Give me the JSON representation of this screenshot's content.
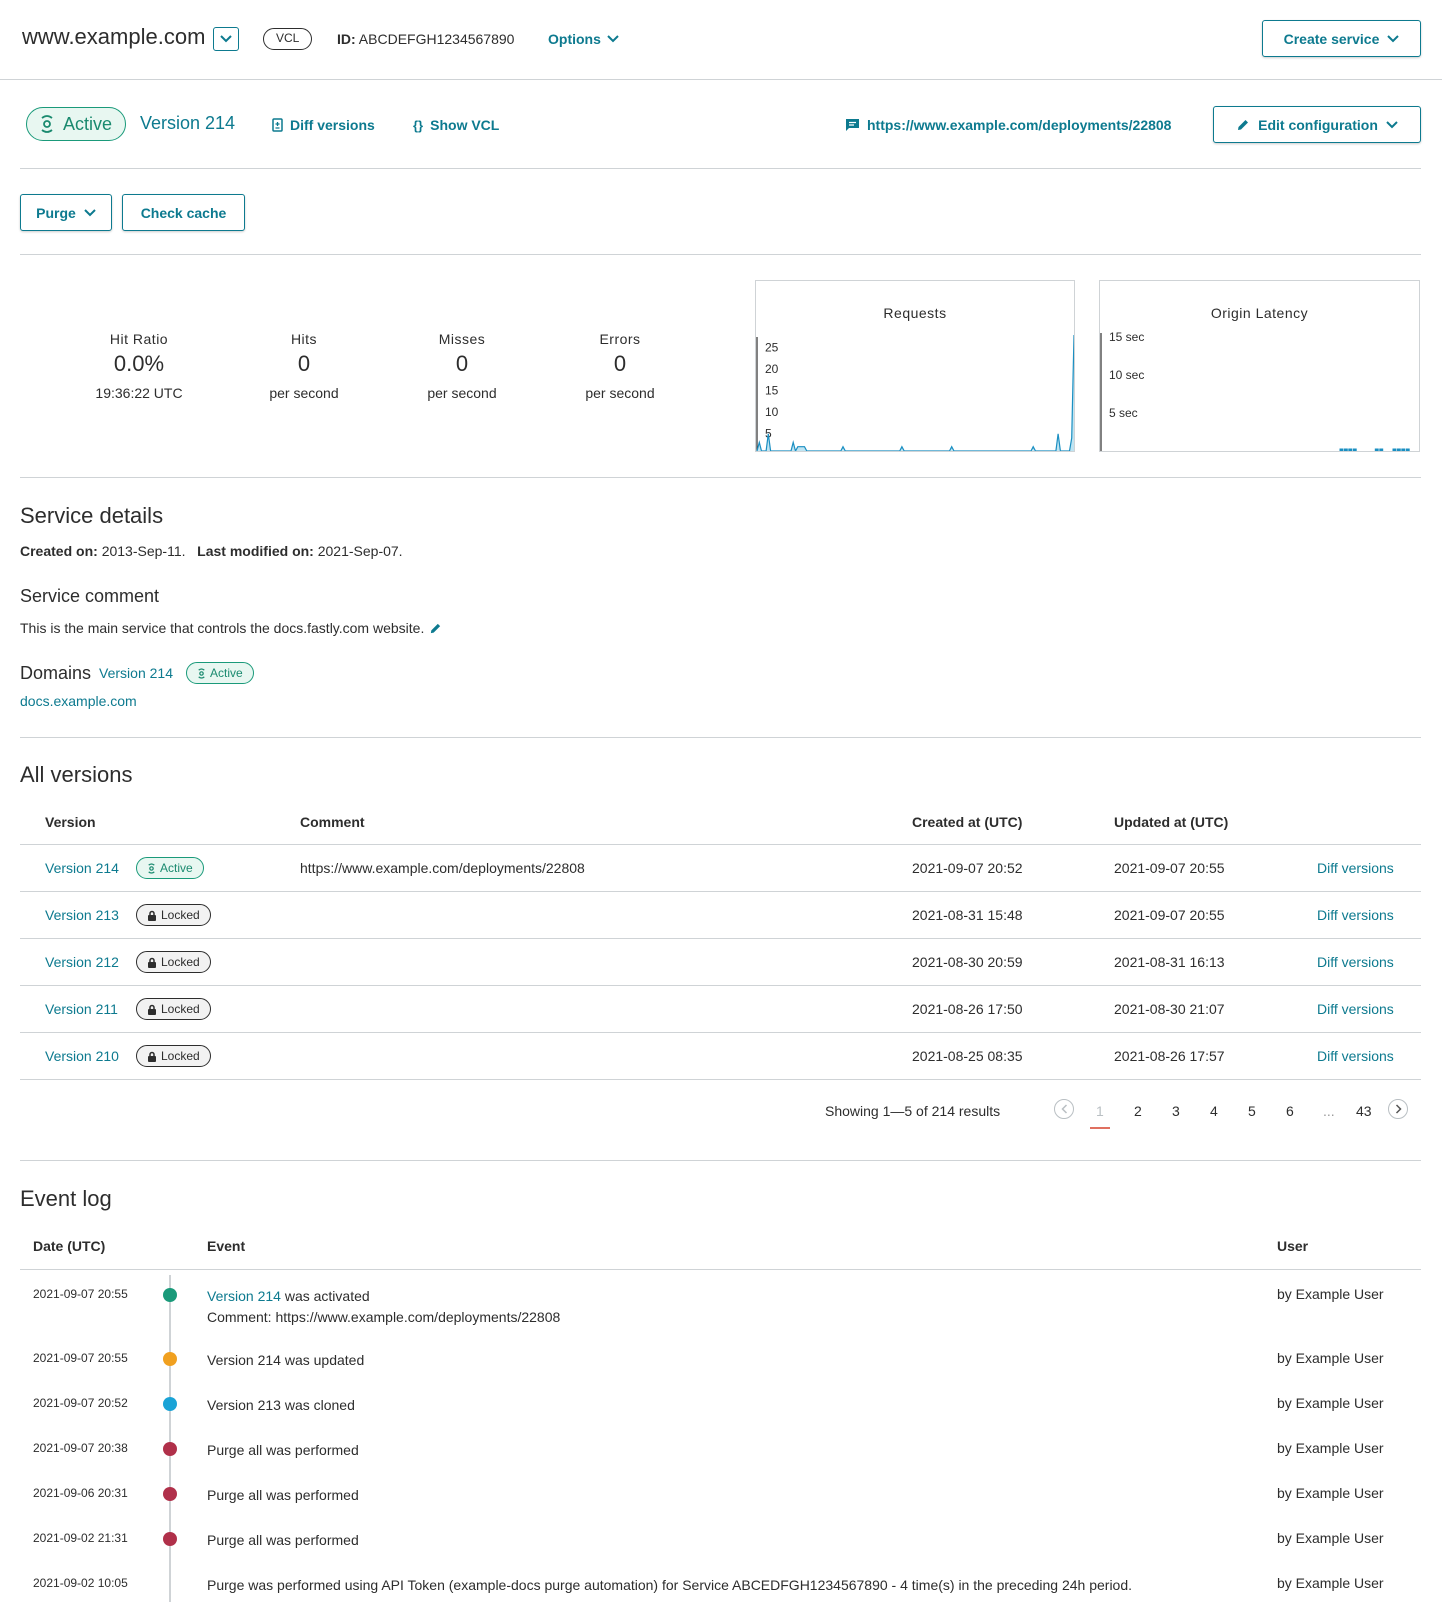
{
  "header": {
    "site_title": "www.example.com",
    "type_badge": "VCL",
    "id_label": "ID:",
    "id_value": "ABCDEFGH1234567890",
    "options_label": "Options",
    "create_service_label": "Create service"
  },
  "version_bar": {
    "status": "Active",
    "version_label": "Version 214",
    "diff_versions_label": "Diff versions",
    "show_vcl_label": "Show VCL",
    "deployment_url": "https://www.example.com/deployments/22808",
    "edit_config_label": "Edit configuration"
  },
  "actions": {
    "purge_label": "Purge",
    "check_cache_label": "Check cache"
  },
  "stats": {
    "hit_ratio": {
      "label": "Hit Ratio",
      "value": "0.0%",
      "sub": "19:36:22 UTC"
    },
    "hits": {
      "label": "Hits",
      "value": "0",
      "sub": "per second"
    },
    "misses": {
      "label": "Misses",
      "value": "0",
      "sub": "per second"
    },
    "errors": {
      "label": "Errors",
      "value": "0",
      "sub": "per second"
    }
  },
  "chart_data": [
    {
      "type": "area",
      "title": "Requests",
      "yticks": [
        "25",
        "20",
        "15",
        "10",
        "5"
      ],
      "ylim": [
        0,
        27
      ],
      "values": [
        0,
        2,
        0,
        0,
        0,
        4,
        0,
        0,
        0,
        0,
        0,
        0,
        0,
        0,
        0,
        0,
        2,
        0,
        1,
        1,
        1,
        1,
        0,
        0,
        0,
        0,
        0,
        0,
        0,
        0,
        0,
        0,
        0,
        0,
        0,
        0,
        0,
        0,
        1,
        0,
        0,
        0,
        0,
        0,
        0,
        0,
        0,
        0,
        0,
        0,
        0,
        0,
        0,
        0,
        0,
        0,
        0,
        0,
        0,
        0,
        0,
        0,
        0,
        0,
        1,
        0,
        0,
        0,
        0,
        0,
        0,
        0,
        0,
        0,
        0,
        0,
        0,
        0,
        0,
        0,
        0,
        0,
        0,
        0,
        0,
        0,
        1,
        0,
        0,
        0,
        0,
        0,
        0,
        0,
        0,
        0,
        0,
        0,
        0,
        0,
        0,
        0,
        0,
        0,
        0,
        0,
        0,
        0,
        0,
        0,
        0,
        0,
        0,
        0,
        0,
        0,
        0,
        0,
        0,
        0,
        0,
        0,
        1,
        0,
        0,
        0,
        0,
        0,
        0,
        0,
        0,
        0,
        0,
        4,
        0,
        0,
        0,
        0,
        0,
        3,
        27
      ],
      "legend": "none"
    },
    {
      "type": "bar",
      "title": "Origin Latency",
      "yticks": [
        "15 sec",
        "10 sec",
        "5 sec"
      ],
      "ylim": [
        0,
        15
      ],
      "values": [
        0,
        0,
        0,
        0,
        0,
        0,
        0,
        0,
        0,
        0,
        0,
        0,
        0,
        0,
        0,
        0,
        0,
        0,
        0,
        0,
        0,
        0,
        0,
        0,
        0,
        0,
        0,
        0,
        0,
        0,
        0,
        0,
        0,
        0,
        0,
        0,
        0,
        0,
        0,
        0,
        0,
        0,
        0,
        0,
        0,
        0,
        0,
        0,
        0,
        0,
        0,
        0,
        0,
        0,
        0.2,
        0.2,
        0.2,
        0.2,
        0,
        0,
        0,
        0,
        0.2,
        0.2,
        0,
        0,
        0.2,
        0.2,
        0.2,
        0.2,
        0,
        0
      ],
      "legend": "none"
    }
  ],
  "service_details": {
    "heading": "Service details",
    "created_label": "Created on:",
    "created_value": "2013-Sep-11.",
    "modified_label": "Last modified on:",
    "modified_value": "2021-Sep-07.",
    "comment_heading": "Service comment",
    "comment_text": "This is the main service that controls the docs.fastly.com website.",
    "domains_heading": "Domains",
    "domains_version": "Version 214",
    "domains_status": "Active",
    "domain": "docs.example.com"
  },
  "versions": {
    "heading": "All versions",
    "columns": [
      "Version",
      "Comment",
      "Created at (UTC)",
      "Updated at (UTC)"
    ],
    "rows": [
      {
        "version": "Version 214",
        "badge": "Active",
        "comment": "https://www.example.com/deployments/22808",
        "created": "2021-09-07 20:52",
        "updated": "2021-09-07 20:55",
        "action": "Diff versions"
      },
      {
        "version": "Version 213",
        "badge": "Locked",
        "comment": "",
        "created": "2021-08-31 15:48",
        "updated": "2021-09-07 20:55",
        "action": "Diff versions"
      },
      {
        "version": "Version 212",
        "badge": "Locked",
        "comment": "",
        "created": "2021-08-30 20:59",
        "updated": "2021-08-31 16:13",
        "action": "Diff versions"
      },
      {
        "version": "Version 211",
        "badge": "Locked",
        "comment": "",
        "created": "2021-08-26 17:50",
        "updated": "2021-08-30 21:07",
        "action": "Diff versions"
      },
      {
        "version": "Version 210",
        "badge": "Locked",
        "comment": "",
        "created": "2021-08-25 08:35",
        "updated": "2021-08-26 17:57",
        "action": "Diff versions"
      }
    ],
    "showing": "Showing 1—5 of 214 results",
    "pages": [
      "1",
      "2",
      "3",
      "4",
      "5",
      "6",
      "...",
      "43"
    ],
    "current_page": "1"
  },
  "event_log": {
    "heading": "Event log",
    "columns": [
      "Date (UTC)",
      "Event",
      "User"
    ],
    "rows": [
      {
        "date": "2021-09-07 20:55",
        "color": "#1a9a7a",
        "link": "Version 214",
        "text": " was activated",
        "line2": "Comment: https://www.example.com/deployments/22808",
        "user": "by Example User"
      },
      {
        "date": "2021-09-07 20:55",
        "color": "#f0a020",
        "link": "",
        "text": "Version 214 was updated",
        "line2": "",
        "user": "by Example User"
      },
      {
        "date": "2021-09-07 20:52",
        "color": "#1aa3d6",
        "link": "",
        "text": "Version 213 was cloned",
        "line2": "",
        "user": "by Example User"
      },
      {
        "date": "2021-09-07 20:38",
        "color": "#b0304a",
        "link": "",
        "text": "Purge all was performed",
        "line2": "",
        "user": "by Example User"
      },
      {
        "date": "2021-09-06 20:31",
        "color": "#b0304a",
        "link": "",
        "text": "Purge all was performed",
        "line2": "",
        "user": "by Example User"
      },
      {
        "date": "2021-09-02 21:31",
        "color": "#b0304a",
        "link": "",
        "text": "Purge all was performed",
        "line2": "",
        "user": "by Example User"
      },
      {
        "date": "2021-09-02 10:05",
        "color": "",
        "link": "",
        "text": "Purge was performed using API Token (example-docs purge automation) for Service ABCEDFGH1234567890 - 4 time(s) in the preceding 24h period.",
        "line2": "",
        "user": "by Example User"
      }
    ]
  },
  "colors": {
    "accent": "#0d7a8f",
    "active": "#1a9a7a",
    "border": "#cfd3d6",
    "chart_fill": "#bfe4f2",
    "chart_line": "#1a8fc2"
  }
}
